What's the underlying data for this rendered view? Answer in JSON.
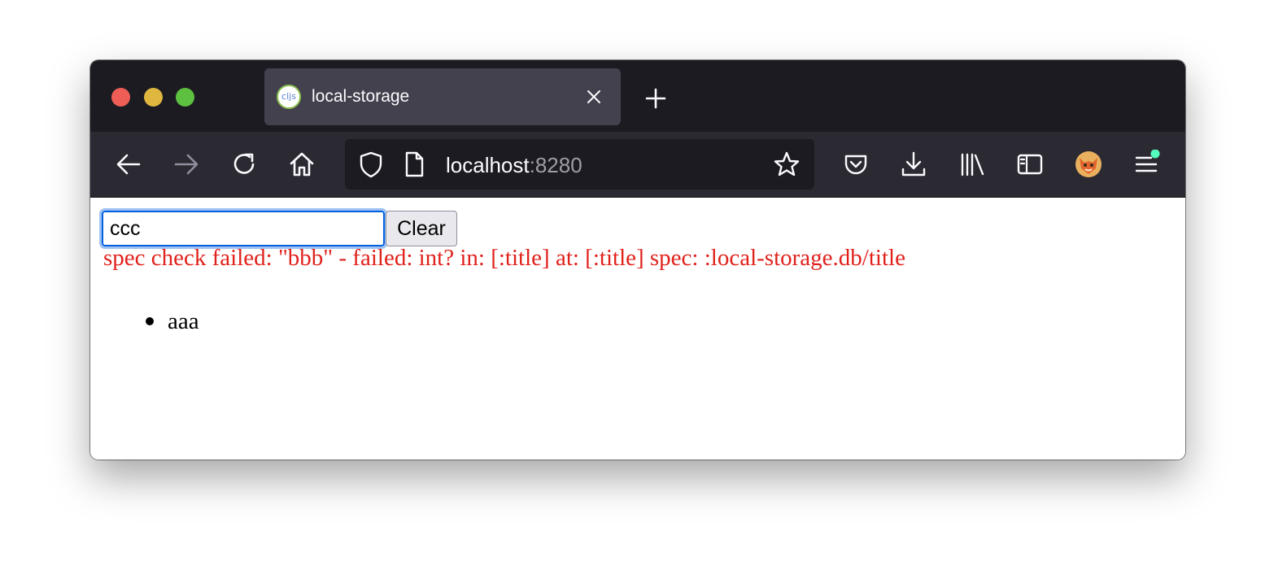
{
  "browser": {
    "tab": {
      "title": "local-storage",
      "favicon_text": "cljs"
    },
    "url": {
      "host": "localhost",
      "port": ":8280"
    },
    "icons": {
      "back": "arrow-left-icon",
      "forward": "arrow-right-icon",
      "reload": "reload-icon",
      "home": "home-icon",
      "shield": "shield-icon",
      "page": "page-icon",
      "bookmark": "star-icon",
      "pocket": "pocket-icon",
      "downloads": "download-icon",
      "library": "library-icon",
      "sidebar": "sidebar-icon",
      "account": "fox-avatar-icon",
      "menu": "hamburger-menu-icon"
    },
    "colors": {
      "titlebar": "#1c1b22",
      "navbar": "#2b2a33",
      "active_tab": "#42414d",
      "notification_dot": "#54ffbd"
    }
  },
  "page": {
    "input_value": "ccc",
    "clear_label": "Clear",
    "error_message": "spec check failed: \"bbb\" - failed: int? in: [:title] at: [:title] spec: :local-storage.db/title",
    "items": [
      "aaa"
    ],
    "colors": {
      "error": "#e0211b",
      "focus_ring": "#0060df"
    }
  }
}
